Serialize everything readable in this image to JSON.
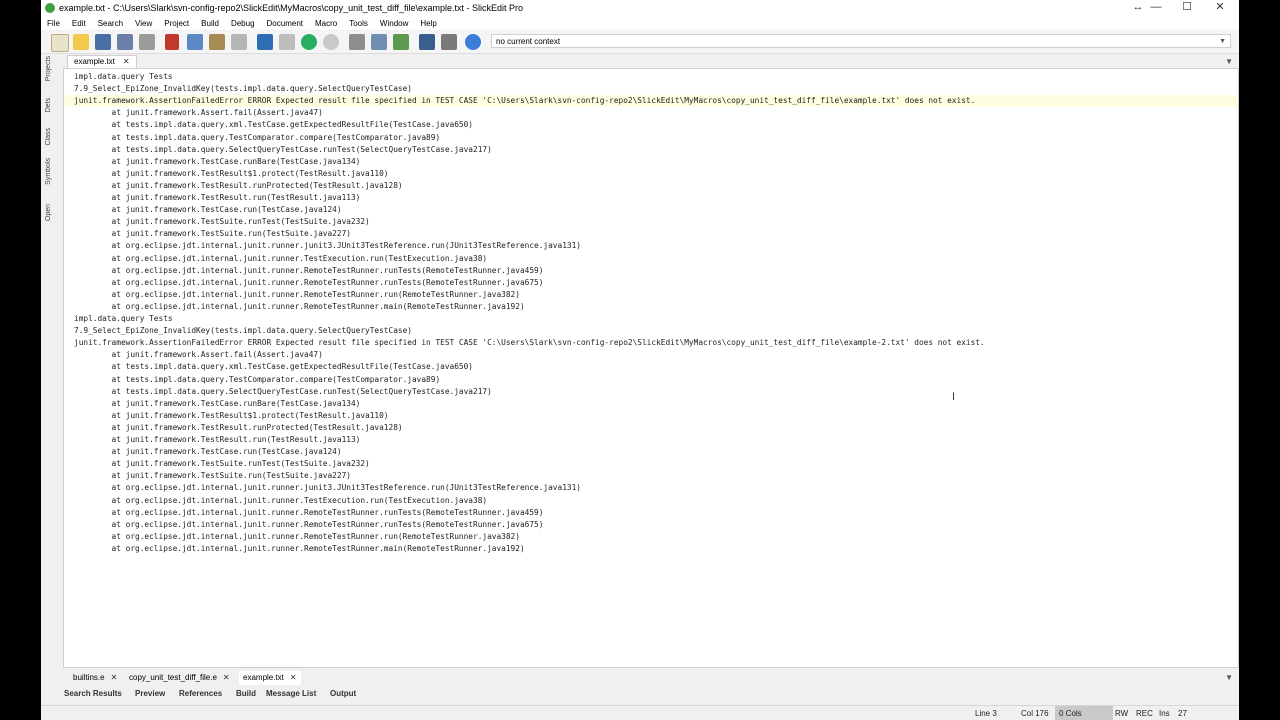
{
  "window": {
    "title": "example.txt - C:\\Users\\Slark\\svn-config-repo2\\SlickEdit\\MyMacros\\copy_unit_test_diff_file\\example.txt - SlickEdit Pro",
    "minimize": "—",
    "maximize": "☐",
    "close": "✕",
    "extra": "↔"
  },
  "menu": [
    "File",
    "Edit",
    "Search",
    "View",
    "Project",
    "Build",
    "Debug",
    "Document",
    "Macro",
    "Tools",
    "Window",
    "Help"
  ],
  "context_box": {
    "value": "no current context"
  },
  "side_tabs": [
    "Projects",
    "Defs",
    "Class",
    "Symbols",
    "Open"
  ],
  "doc_tab": {
    "label": "example.txt"
  },
  "editor_lines": [
    "impl.data.query Tests",
    "7.9_Select_EpiZone_InvalidKey(tests.impl.data.query.SelectQueryTestCase)",
    "junit.framework.AssertionFailedError ERROR Expected result file specified in TEST CASE 'C:\\Users\\Slark\\svn-config-repo2\\SlickEdit\\MyMacros\\copy_unit_test_diff_file\\example.txt' does not exist.",
    "        at junit.framework.Assert.fail(Assert.java47)",
    "        at tests.impl.data.query.xml.TestCase.getExpectedResultFile(TestCase.java650)",
    "        at tests.impl.data.query.TestComparator.compare(TestComparator.java89)",
    "        at tests.impl.data.query.SelectQueryTestCase.runTest(SelectQueryTestCase.java217)",
    "        at junit.framework.TestCase.runBare(TestCase.java134)",
    "        at junit.framework.TestResult$1.protect(TestResult.java110)",
    "        at junit.framework.TestResult.runProtected(TestResult.java128)",
    "        at junit.framework.TestResult.run(TestResult.java113)",
    "        at junit.framework.TestCase.run(TestCase.java124)",
    "        at junit.framework.TestSuite.runTest(TestSuite.java232)",
    "        at junit.framework.TestSuite.run(TestSuite.java227)",
    "        at org.eclipse.jdt.internal.junit.runner.junit3.JUnit3TestReference.run(JUnit3TestReference.java131)",
    "        at org.eclipse.jdt.internal.junit.runner.TestExecution.run(TestExecution.java38)",
    "        at org.eclipse.jdt.internal.junit.runner.RemoteTestRunner.runTests(RemoteTestRunner.java459)",
    "        at org.eclipse.jdt.internal.junit.runner.RemoteTestRunner.runTests(RemoteTestRunner.java675)",
    "        at org.eclipse.jdt.internal.junit.runner.RemoteTestRunner.run(RemoteTestRunner.java382)",
    "        at org.eclipse.jdt.internal.junit.runner.RemoteTestRunner.main(RemoteTestRunner.java192)",
    "impl.data.query Tests",
    "7.9_Select_EpiZone_InvalidKey(tests.impl.data.query.SelectQueryTestCase)",
    "junit.framework.AssertionFailedError ERROR Expected result file specified in TEST CASE 'C:\\Users\\Slark\\svn-config-repo2\\SlickEdit\\MyMacros\\copy_unit_test_diff_file\\example-2.txt' does not exist.",
    "        at junit.framework.Assert.fail(Assert.java47)",
    "        at tests.impl.data.query.xml.TestCase.getExpectedResultFile(TestCase.java650)",
    "        at tests.impl.data.query.TestComparator.compare(TestComparator.java89)",
    "        at tests.impl.data.query.SelectQueryTestCase.runTest(SelectQueryTestCase.java217)",
    "        at junit.framework.TestCase.runBare(TestCase.java134)",
    "        at junit.framework.TestResult$1.protect(TestResult.java110)",
    "        at junit.framework.TestResult.runProtected(TestResult.java128)",
    "        at junit.framework.TestResult.run(TestResult.java113)",
    "        at junit.framework.TestCase.run(TestCase.java124)",
    "        at junit.framework.TestSuite.runTest(TestSuite.java232)",
    "        at junit.framework.TestSuite.run(TestSuite.java227)",
    "        at org.eclipse.jdt.internal.junit.runner.junit3.JUnit3TestReference.run(JUnit3TestReference.java131)",
    "        at org.eclipse.jdt.internal.junit.runner.TestExecution.run(TestExecution.java38)",
    "        at org.eclipse.jdt.internal.junit.runner.RemoteTestRunner.runTests(RemoteTestRunner.java459)",
    "        at org.eclipse.jdt.internal.junit.runner.RemoteTestRunner.runTests(RemoteTestRunner.java675)",
    "        at org.eclipse.jdt.internal.junit.runner.RemoteTestRunner.run(RemoteTestRunner.java382)",
    "        at org.eclipse.jdt.internal.junit.runner.RemoteTestRunner.main(RemoteTestRunner.java192)"
  ],
  "bottom_tabs": [
    {
      "label": "builtins.e"
    },
    {
      "label": "copy_unit_test_diff_file.e"
    },
    {
      "label": "example.txt"
    }
  ],
  "panel_tabs": [
    "Search Results",
    "Preview",
    "References",
    "Build",
    "Message List",
    "Output"
  ],
  "status": {
    "line": "Line 3",
    "col": "Col 176",
    "cols": "0 Cols",
    "rw": "RW",
    "rec": "REC",
    "ins": "Ins",
    "num": "27"
  },
  "colors": {
    "accent": "#3aa33a",
    "current_line": "#fffde0",
    "background": "#ffffff"
  }
}
